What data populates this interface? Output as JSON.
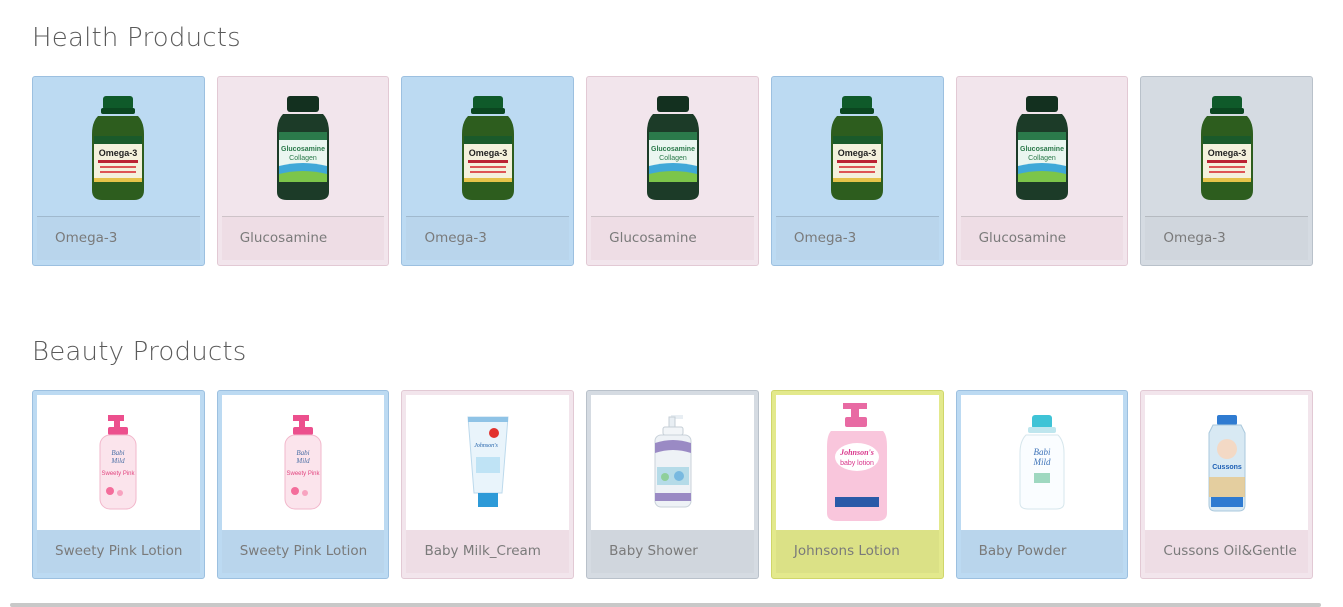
{
  "health": {
    "title": "Health Products",
    "items": [
      {
        "label": "Omega-3",
        "icon": "omega3-bottle-icon",
        "color": "#bcdaf2"
      },
      {
        "label": "Glucosamine",
        "icon": "glucosamine-bottle-icon",
        "color": "#f2e5ec"
      },
      {
        "label": "Omega-3",
        "icon": "omega3-bottle-icon",
        "color": "#bcdaf2"
      },
      {
        "label": "Glucosamine",
        "icon": "glucosamine-bottle-icon",
        "color": "#f2e5ec"
      },
      {
        "label": "Omega-3",
        "icon": "omega3-bottle-icon",
        "color": "#bcdaf2"
      },
      {
        "label": "Glucosamine",
        "icon": "glucosamine-bottle-icon",
        "color": "#f2e5ec"
      },
      {
        "label": "Omega-3",
        "icon": "omega3-bottle-icon",
        "color": "#d5dbe2"
      }
    ]
  },
  "beauty": {
    "title": "Beauty Products",
    "items": [
      {
        "label": "Sweety Pink Lotion",
        "icon": "pink-pump-bottle-icon",
        "color": "#bcdaf2"
      },
      {
        "label": "Sweety Pink Lotion",
        "icon": "pink-pump-bottle-icon",
        "color": "#bcdaf2"
      },
      {
        "label": "Baby Milk_Cream",
        "icon": "cream-tube-icon",
        "color": "#f2e5ec"
      },
      {
        "label": "Baby Shower",
        "icon": "shower-gel-bottle-icon",
        "color": "#d5dbe2"
      },
      {
        "label": "Johnsons Lotion",
        "icon": "pink-lotion-bottle-icon",
        "color": "#e3e98c"
      },
      {
        "label": "Baby Powder",
        "icon": "powder-bottle-icon",
        "color": "#bcdaf2"
      },
      {
        "label": "Cussons Oil&Gentle",
        "icon": "oil-bottle-icon",
        "color": "#f2e5ec"
      }
    ]
  }
}
